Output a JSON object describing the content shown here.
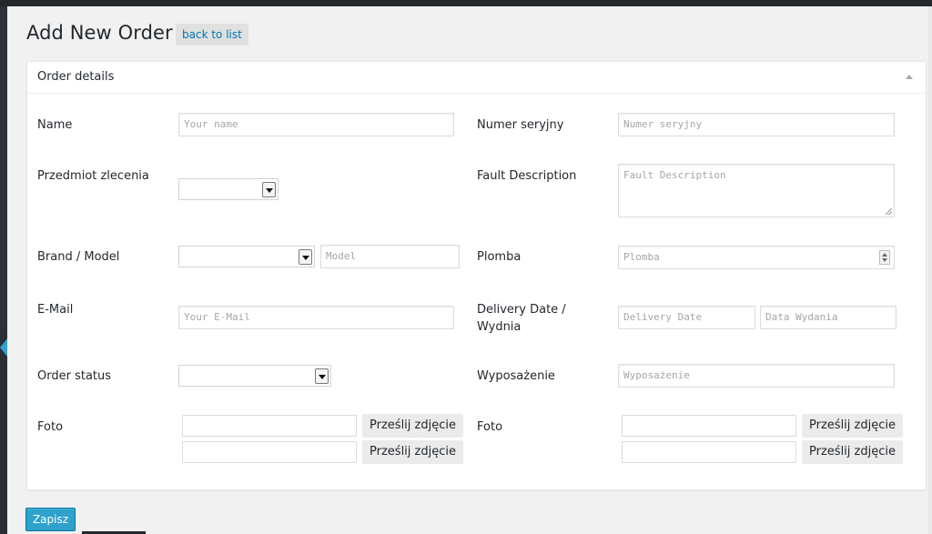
{
  "page": {
    "title": "Add New Order",
    "back_label": "back to list",
    "save_label": "Zapisz"
  },
  "box": {
    "title": "Order details"
  },
  "left": {
    "name": {
      "label": "Name",
      "placeholder": "Your name"
    },
    "subject": {
      "label": "Przedmiot zlecenia",
      "value": ""
    },
    "brand_model": {
      "label": "Brand / Model",
      "brand_value": "",
      "model_placeholder": "Model"
    },
    "email": {
      "label": "E-Mail",
      "placeholder": "Your E-Mail"
    },
    "status": {
      "label": "Order status",
      "value": ""
    },
    "foto": {
      "label": "Foto",
      "upload_label_1": "Prześlij zdjęcie",
      "upload_label_2": "Prześlij zdjęcie"
    }
  },
  "right": {
    "serial": {
      "label": "Numer seryjny",
      "placeholder": "Numer seryjny"
    },
    "fault": {
      "label": "Fault Description",
      "placeholder": "Fault Description"
    },
    "seal": {
      "label": "Plomba",
      "placeholder": "Plomba"
    },
    "delivery": {
      "label_line1": "Delivery Date /",
      "label_line2": "Wydnia",
      "delivery_placeholder": "Delivery Date",
      "issue_placeholder": "Data Wydania"
    },
    "equipment": {
      "label": "Wyposażenie",
      "placeholder": "Wyposażenie"
    },
    "foto": {
      "label": "Foto",
      "upload_label_1": "Prześlij zdjęcie",
      "upload_label_2": "Prześlij zdjęcie"
    }
  },
  "colors": {
    "primary_button": "#2ea2cc",
    "admin_bar": "#23282d",
    "link": "#0073aa"
  },
  "icons": {
    "toggle": "triangle-up-icon",
    "select_arrow": "chevron-down-icon",
    "spinner": "spinner-arrows-icon",
    "collapse": "caret-left-icon"
  }
}
